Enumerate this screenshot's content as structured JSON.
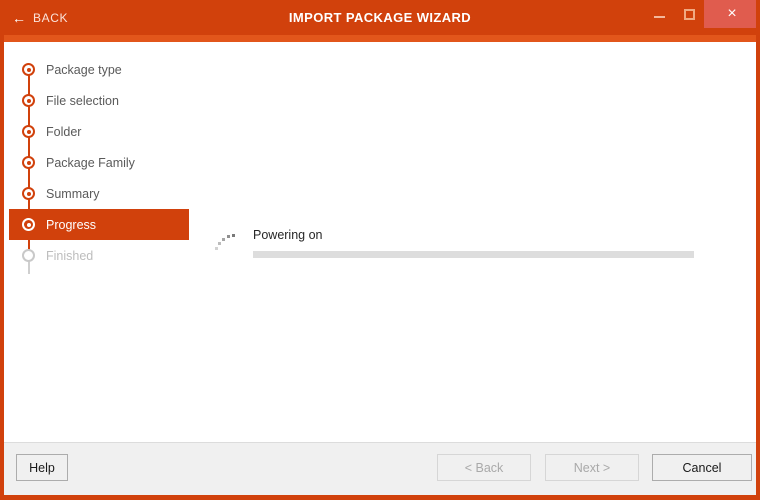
{
  "titlebar": {
    "back_icon": "arrow-left-icon",
    "back_label": "BACK",
    "title": "IMPORT PACKAGE WIZARD",
    "minimize_glyph": "minimize-icon",
    "maximize_glyph": "maximize-icon",
    "close_glyph": "×"
  },
  "theme": {
    "accent": "#d1410c",
    "accent_light": "#e2561b",
    "close_button": "#e05c4e",
    "footer_bg": "#f0f0f0",
    "progress_track": "#dddddd",
    "step_label": "#5a5a5a",
    "step_pending": "#bdbdbd"
  },
  "sidebar": {
    "steps": [
      {
        "label": "Package type",
        "state": "complete"
      },
      {
        "label": "File selection",
        "state": "complete"
      },
      {
        "label": "Folder",
        "state": "complete"
      },
      {
        "label": "Package Family",
        "state": "complete"
      },
      {
        "label": "Summary",
        "state": "complete"
      },
      {
        "label": "Progress",
        "state": "active"
      },
      {
        "label": "Finished",
        "state": "pending"
      }
    ]
  },
  "main": {
    "spinner_icon": "dotted-spinner-icon",
    "task_label": "Powering on",
    "progress_percent": 0
  },
  "footer": {
    "help_label": "Help",
    "back_label": "< Back",
    "next_label": "Next >",
    "cancel_label": "Cancel"
  }
}
